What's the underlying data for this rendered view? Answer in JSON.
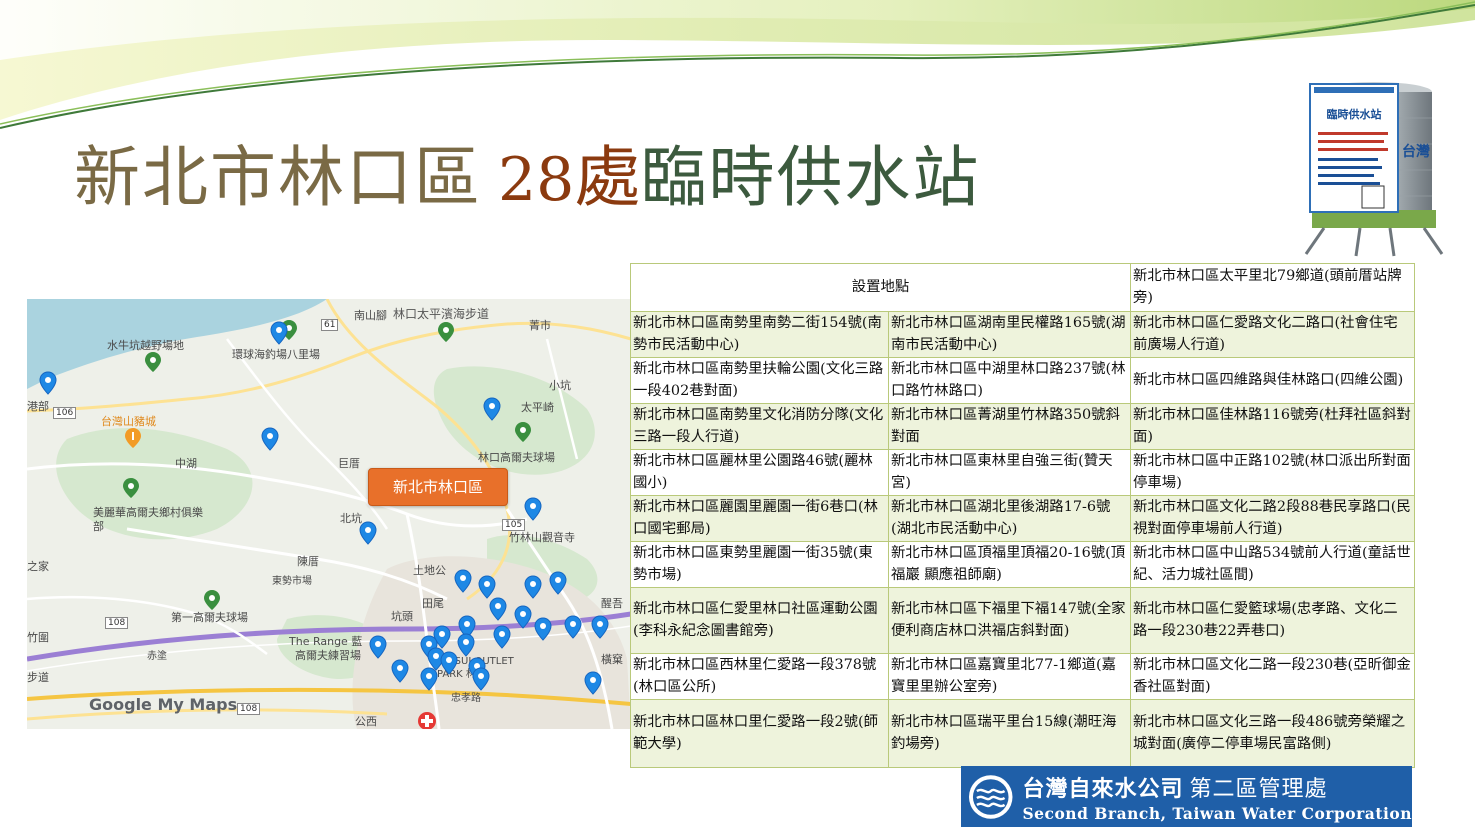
{
  "title": {
    "part1": "新北市林口區",
    "number": "28",
    "unit": "處",
    "part2": "臨時供水站"
  },
  "tank_sign": {
    "label": "臨時供水站",
    "side_text": "台灣"
  },
  "map": {
    "callout": "新北市林口區",
    "attribution": "Google My Maps",
    "labels": {
      "linkou_taiping_trail": "林口太平濱海步道",
      "nankengshan": "南山腳",
      "shuiniukeng": "水牛坑越野場地",
      "huanqiu": "環球海釣場八里場",
      "tongbu": "港部",
      "taiwan_pig_city": "台灣山豬城",
      "zhonghu": "中湖",
      "jiamao": "巨厝",
      "xiaokeng": "小坑",
      "taipingqi": "太平崎",
      "zhaoti": "菁市",
      "linkou_golf": "林口高爾夫球場",
      "meili_golf": "美麗華高爾夫鄉村俱樂部",
      "beigang": "北坑",
      "chenliao": "陳厝",
      "dongshi_market": "東勢市場",
      "tudigong": "土地公",
      "jiazhai": "之家",
      "bamboo_temple": "竹林山觀音寺",
      "tianliao": "田尾",
      "kenggu": "坑頭",
      "diyi_golf": "第一高爾夫球場",
      "zhugang": "竹圍",
      "the_range": "The Range 藍",
      "gaoer_practice": "高爾夫練習場",
      "chilong": "赤塗",
      "bu_dao": "步道",
      "mitsui_outlet": "MITSUI OUTLET PARK 林口",
      "zhongxiao": "忠孝路",
      "gongzuo": "公西",
      "hengke": "橫窠",
      "xingzhuang": "醒吾"
    },
    "shields": [
      "61",
      "106",
      "105",
      "108",
      "108"
    ]
  },
  "table": {
    "header": "設置地點",
    "header_col3": "新北市林口區太平里北79鄉道(頭前厝站牌旁)",
    "rows": [
      [
        "新北市林口區南勢里南勢二街154號(南勢市民活動中心)",
        "新北市林口區湖南里民權路165號(湖南市民活動中心)",
        "新北市林口區仁愛路文化二路口(社會住宅前廣場人行道)"
      ],
      [
        "新北市林口區南勢里扶輪公園(文化三路一段402巷對面)",
        "新北市林口區中湖里林口路237號(林口路竹林路口)",
        "新北市林口區四維路與佳林路口(四維公園)"
      ],
      [
        "新北市林口區南勢里文化消防分隊(文化三路一段人行道)",
        "新北市林口區菁湖里竹林路350號斜對面",
        "新北市林口區佳林路116號旁(杜拜社區斜對面)"
      ],
      [
        "新北市林口區麗林里公園路46號(麗林國小)",
        "新北市林口區東林里自強三街(贊天宮)",
        "新北市林口區中正路102號(林口派出所對面停車場)"
      ],
      [
        "新北市林口區麗園里麗園一街6巷口(林口國宅郵局)",
        "新北市林口區湖北里後湖路17-6號(湖北市民活動中心)",
        "新北市林口區文化二路2段88巷民享路口(民視對面停車場前人行道)"
      ],
      [
        "新北市林口區東勢里麗園一街35號(東勢市場)",
        "新北市林口區頂福里頂福20-16號(頂福巖 顯應祖師廟)",
        "新北市林口區中山路534號前人行道(童話世紀、活力城社區間)"
      ],
      [
        "新北市林口區仁愛里林口社區運動公園(李科永紀念圖書館旁)",
        "新北市林口區下福里下福147號(全家便利商店林口洪福店斜對面)",
        "新北市林口區仁愛籃球場(忠孝路、文化二路一段230巷22弄巷口)"
      ],
      [
        "新北市林口區西林里仁愛路一段378號(林口區公所)",
        "新北市林口區嘉寶里北77-1鄉道(嘉寶里里辦公室旁)",
        "新北市林口區文化二路一段230巷(亞昕御金香社區對面)"
      ],
      [
        "新北市林口區林口里仁愛路一段2號(師範大學)",
        "新北市林口區瑞平里台15線(潮旺海釣場旁)",
        "新北市林口區文化三路一段486號旁榮耀之城對面(廣停二停車場民富路側)"
      ]
    ]
  },
  "logo": {
    "name_zh": "台灣自來水公司",
    "branch_zh": "第二區管理處",
    "name_en": "Second Branch, Taiwan Water Corporation"
  },
  "colors": {
    "title_brown": "#7a6a45",
    "title_rust": "#8b3a0f",
    "title_green": "#3c5a3e",
    "table_border": "#b9c97a",
    "logo_blue": "#1f5fa8",
    "callout_orange": "#e8702a",
    "pin_blue": "#1e88e5"
  }
}
